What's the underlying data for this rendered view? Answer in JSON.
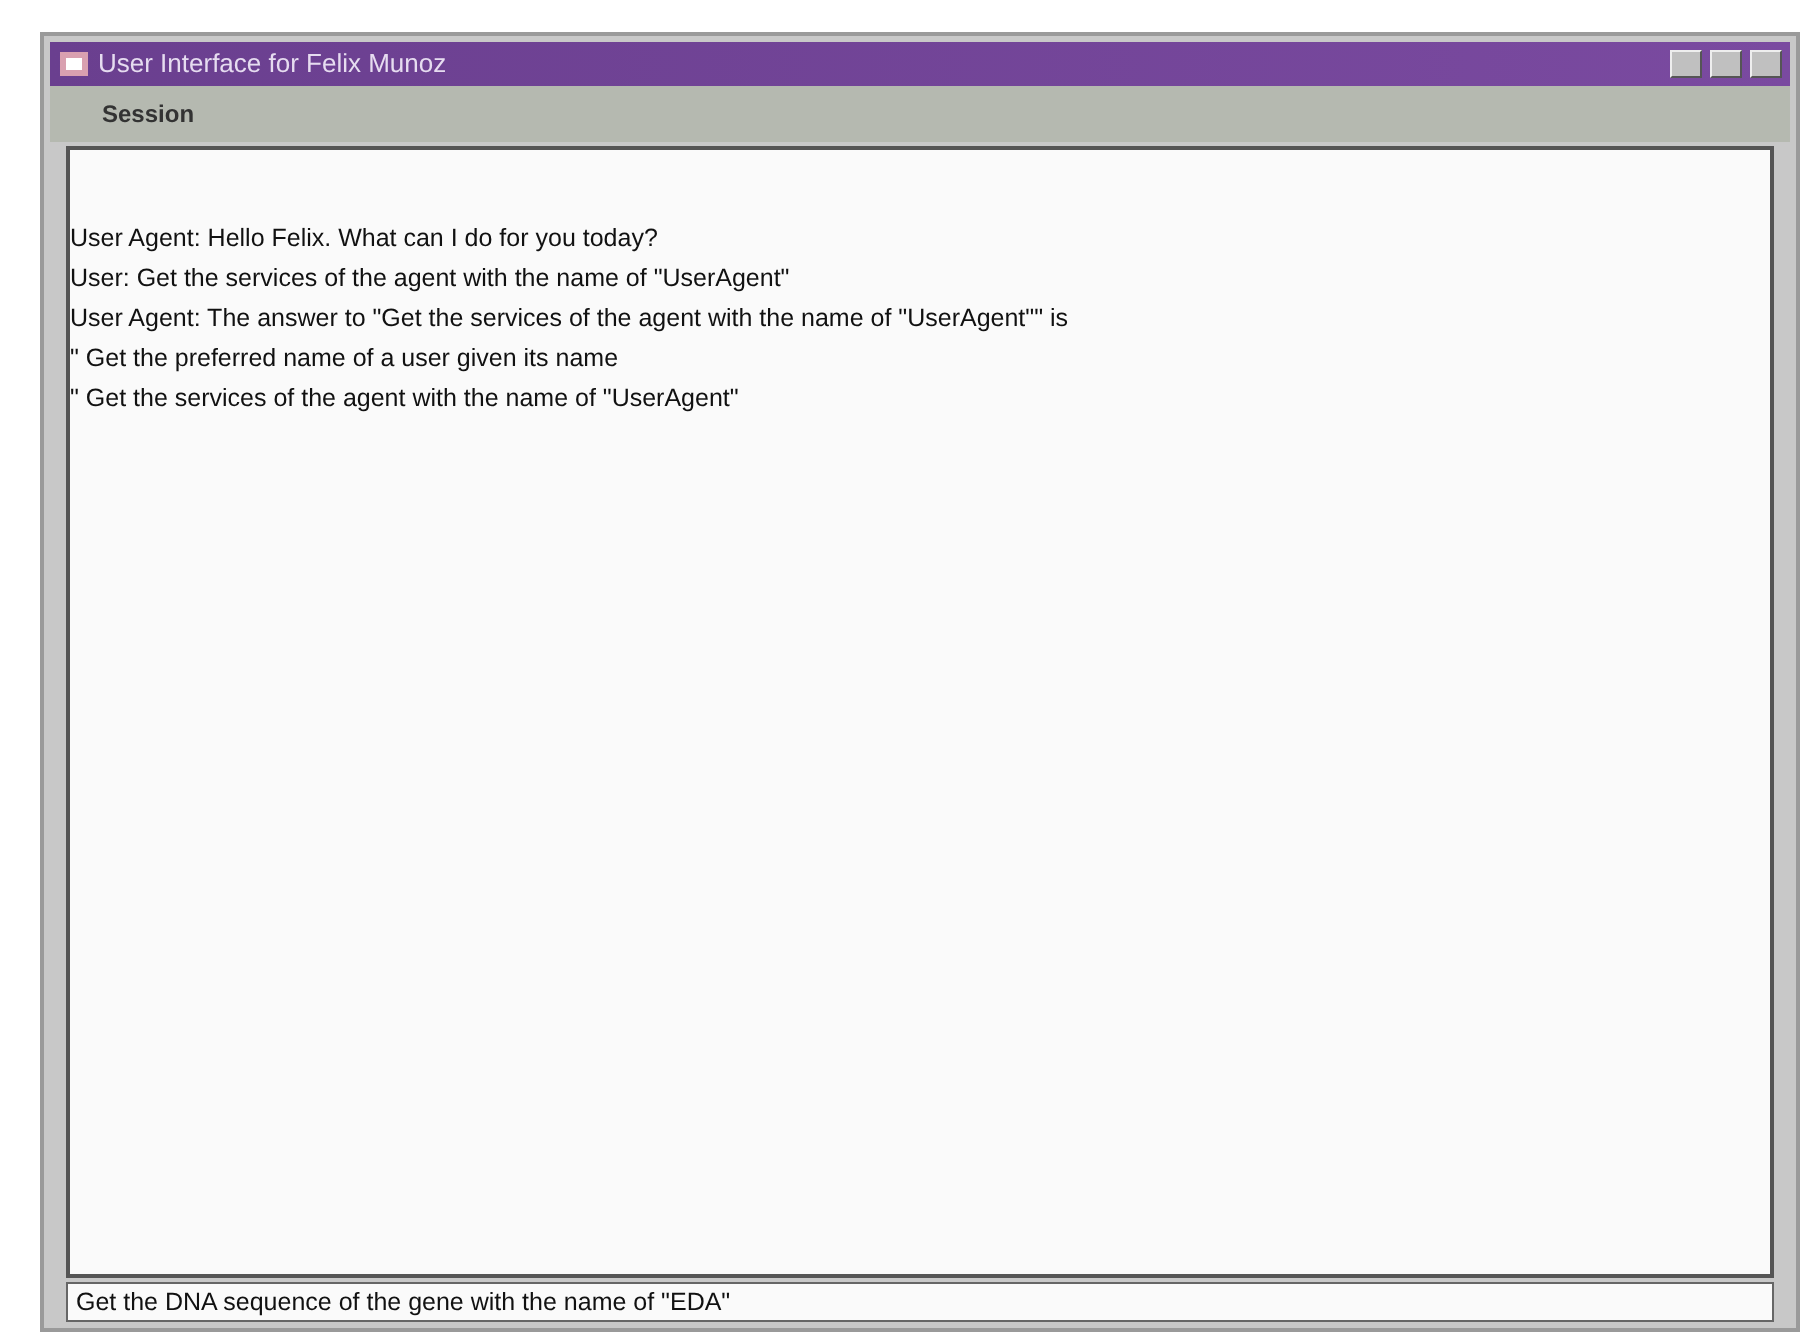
{
  "window": {
    "title": "User Interface for Felix Munoz"
  },
  "menu": [
    "Session"
  ],
  "transcript": [
    "User Agent: Hello Felix. What can I do for you today?",
    "User: Get the services of the agent with the name of \"UserAgent\"",
    "User Agent: The answer to \"Get the services of the agent with the name of \"UserAgent\"\" is",
    "\" Get the preferred name of a user given its name",
    "\" Get the services of the agent with the name of \"UserAgent\""
  ],
  "input": {
    "value": "Get the DNA sequence of the gene with the name of \"EDA\""
  }
}
